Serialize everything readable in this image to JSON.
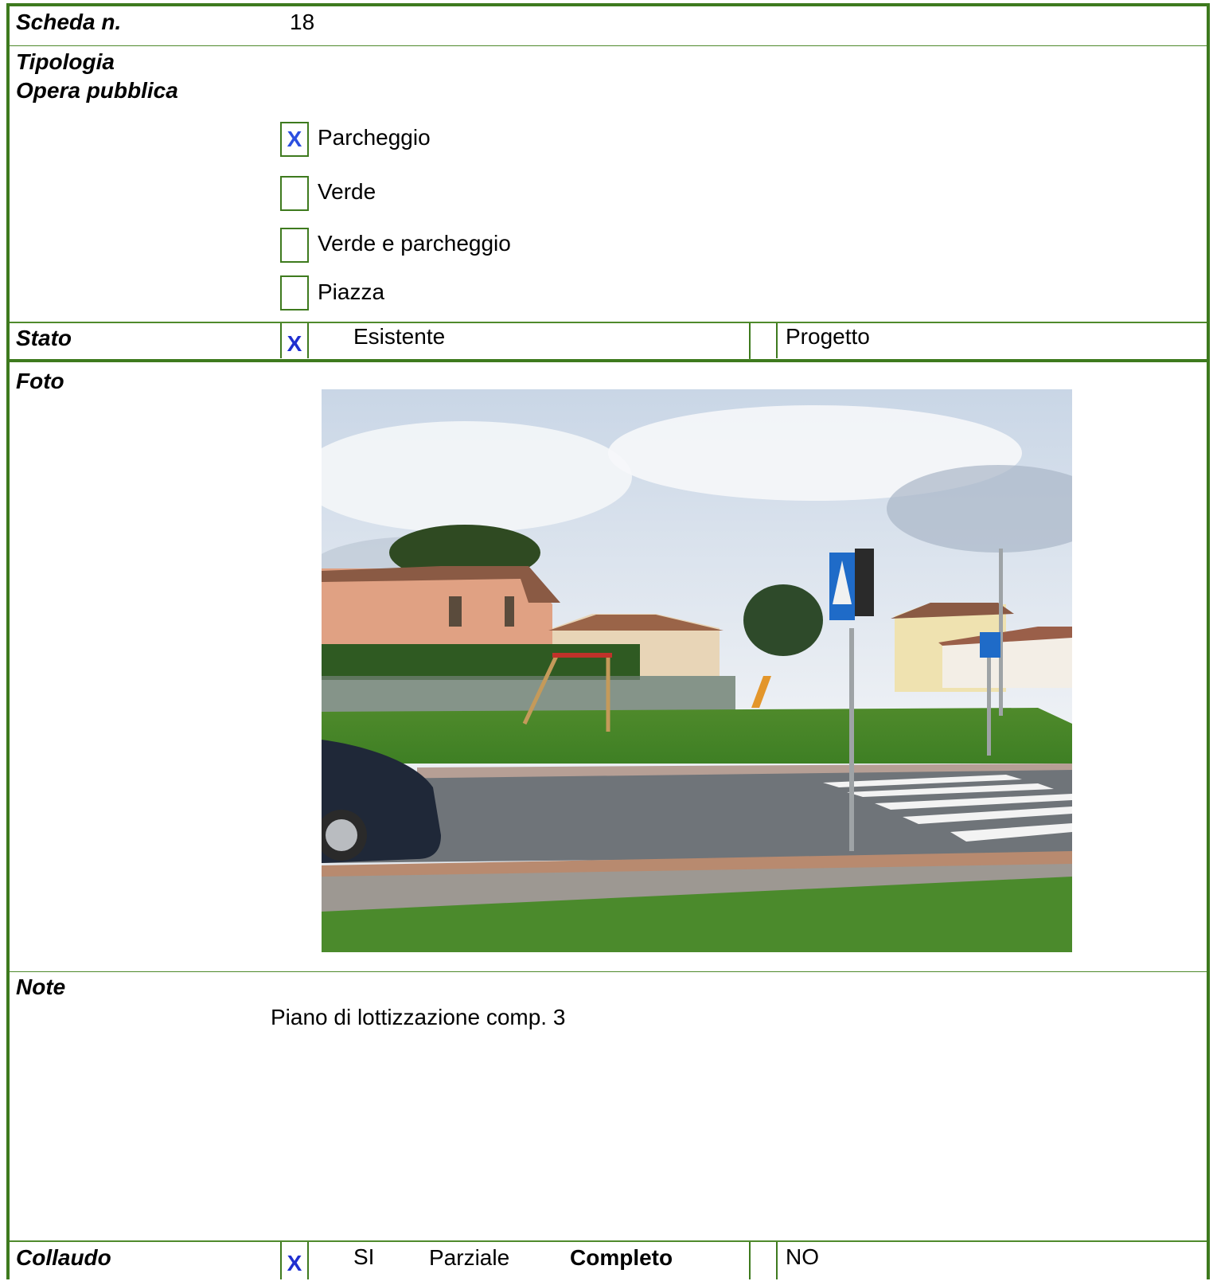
{
  "scheda": {
    "label": "Scheda n.",
    "value": "18"
  },
  "tipologia": {
    "label_line1": "Tipologia",
    "label_line2": "Opera pubblica",
    "options": [
      {
        "mark": "X",
        "label": "Parcheggio"
      },
      {
        "mark": "",
        "label": "Verde"
      },
      {
        "mark": "",
        "label": "Verde e parcheggio"
      },
      {
        "mark": "",
        "label": "Piazza"
      }
    ]
  },
  "stato": {
    "label": "Stato",
    "mark": "X",
    "option1": "Esistente",
    "option2": "Progetto"
  },
  "foto": {
    "label": "Foto"
  },
  "note": {
    "label": "Note",
    "text": "Piano di lottizzazione comp. 3"
  },
  "collaudo": {
    "label": "Collaudo",
    "mark": "X",
    "si": "SI",
    "parziale": "Parziale",
    "completo": "Completo",
    "no": "NO"
  },
  "colors": {
    "border": "#3e7a1e",
    "checkmark": "#2b4fe0"
  }
}
